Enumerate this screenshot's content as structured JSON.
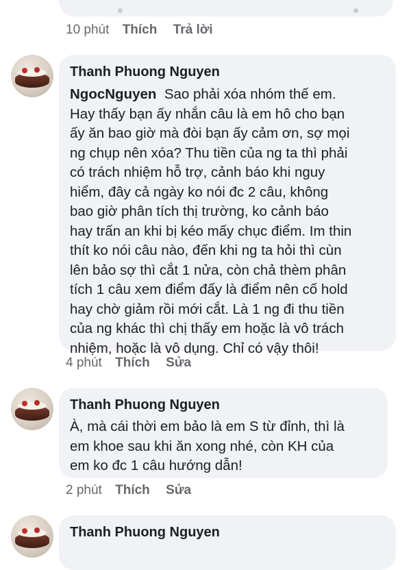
{
  "top_comment": {
    "time": "10 phút",
    "like_label": "Thích",
    "reply_label": "Trả lời"
  },
  "comments": [
    {
      "author": "Thanh Phuong Nguyen",
      "mention": "NgocNguyen",
      "lines": [
        "  Sao phải xóa nhóm thế em.",
        "Hay thấy bạn ấy nhắn câu là em hô cho bạn",
        "ấy ăn bao giờ mà đòi bạn ấy cảm ơn, sợ mọi",
        "ng chụp nên xóa? Thu tiền của ng ta thì phải",
        "có trách nhiệm hỗ trợ, cảnh báo khi nguy",
        "hiểm, đây cả ngày ko nói đc 2 câu, không",
        "bao giờ phân tích thị trường, ko cảnh báo",
        "hay trấn an khi bị kéo mấy chục điểm. Im thin",
        "thít ko nói câu nào, đến khi ng ta hỏi thì cùn",
        "lên bảo sợ thì cắt 1 nửa, còn chả thèm phân",
        "tích 1 câu xem điểm đấy là điểm nên cố hold",
        "hay chờ giảm rồi mới cắt. Là 1 ng đi thu tiền",
        "của ng khác thì chị thấy em hoặc là vô trách",
        "nhiệm, hoặc là vô dụng. Chỉ có vậy thôi!"
      ],
      "time": "4 phút",
      "like_label": "Thích",
      "edit_label": "Sửa"
    },
    {
      "author": "Thanh Phuong Nguyen",
      "lines": [
        "À, mà cái thời em bảo là em S từ đỉnh, thì là",
        "em khoe sau khi ăn xong nhé, còn KH của",
        "em ko đc 1 câu hướng dẫn!"
      ],
      "time": "2 phút",
      "like_label": "Thích",
      "edit_label": "Sửa"
    },
    {
      "author": "Thanh Phuong Nguyen"
    }
  ]
}
